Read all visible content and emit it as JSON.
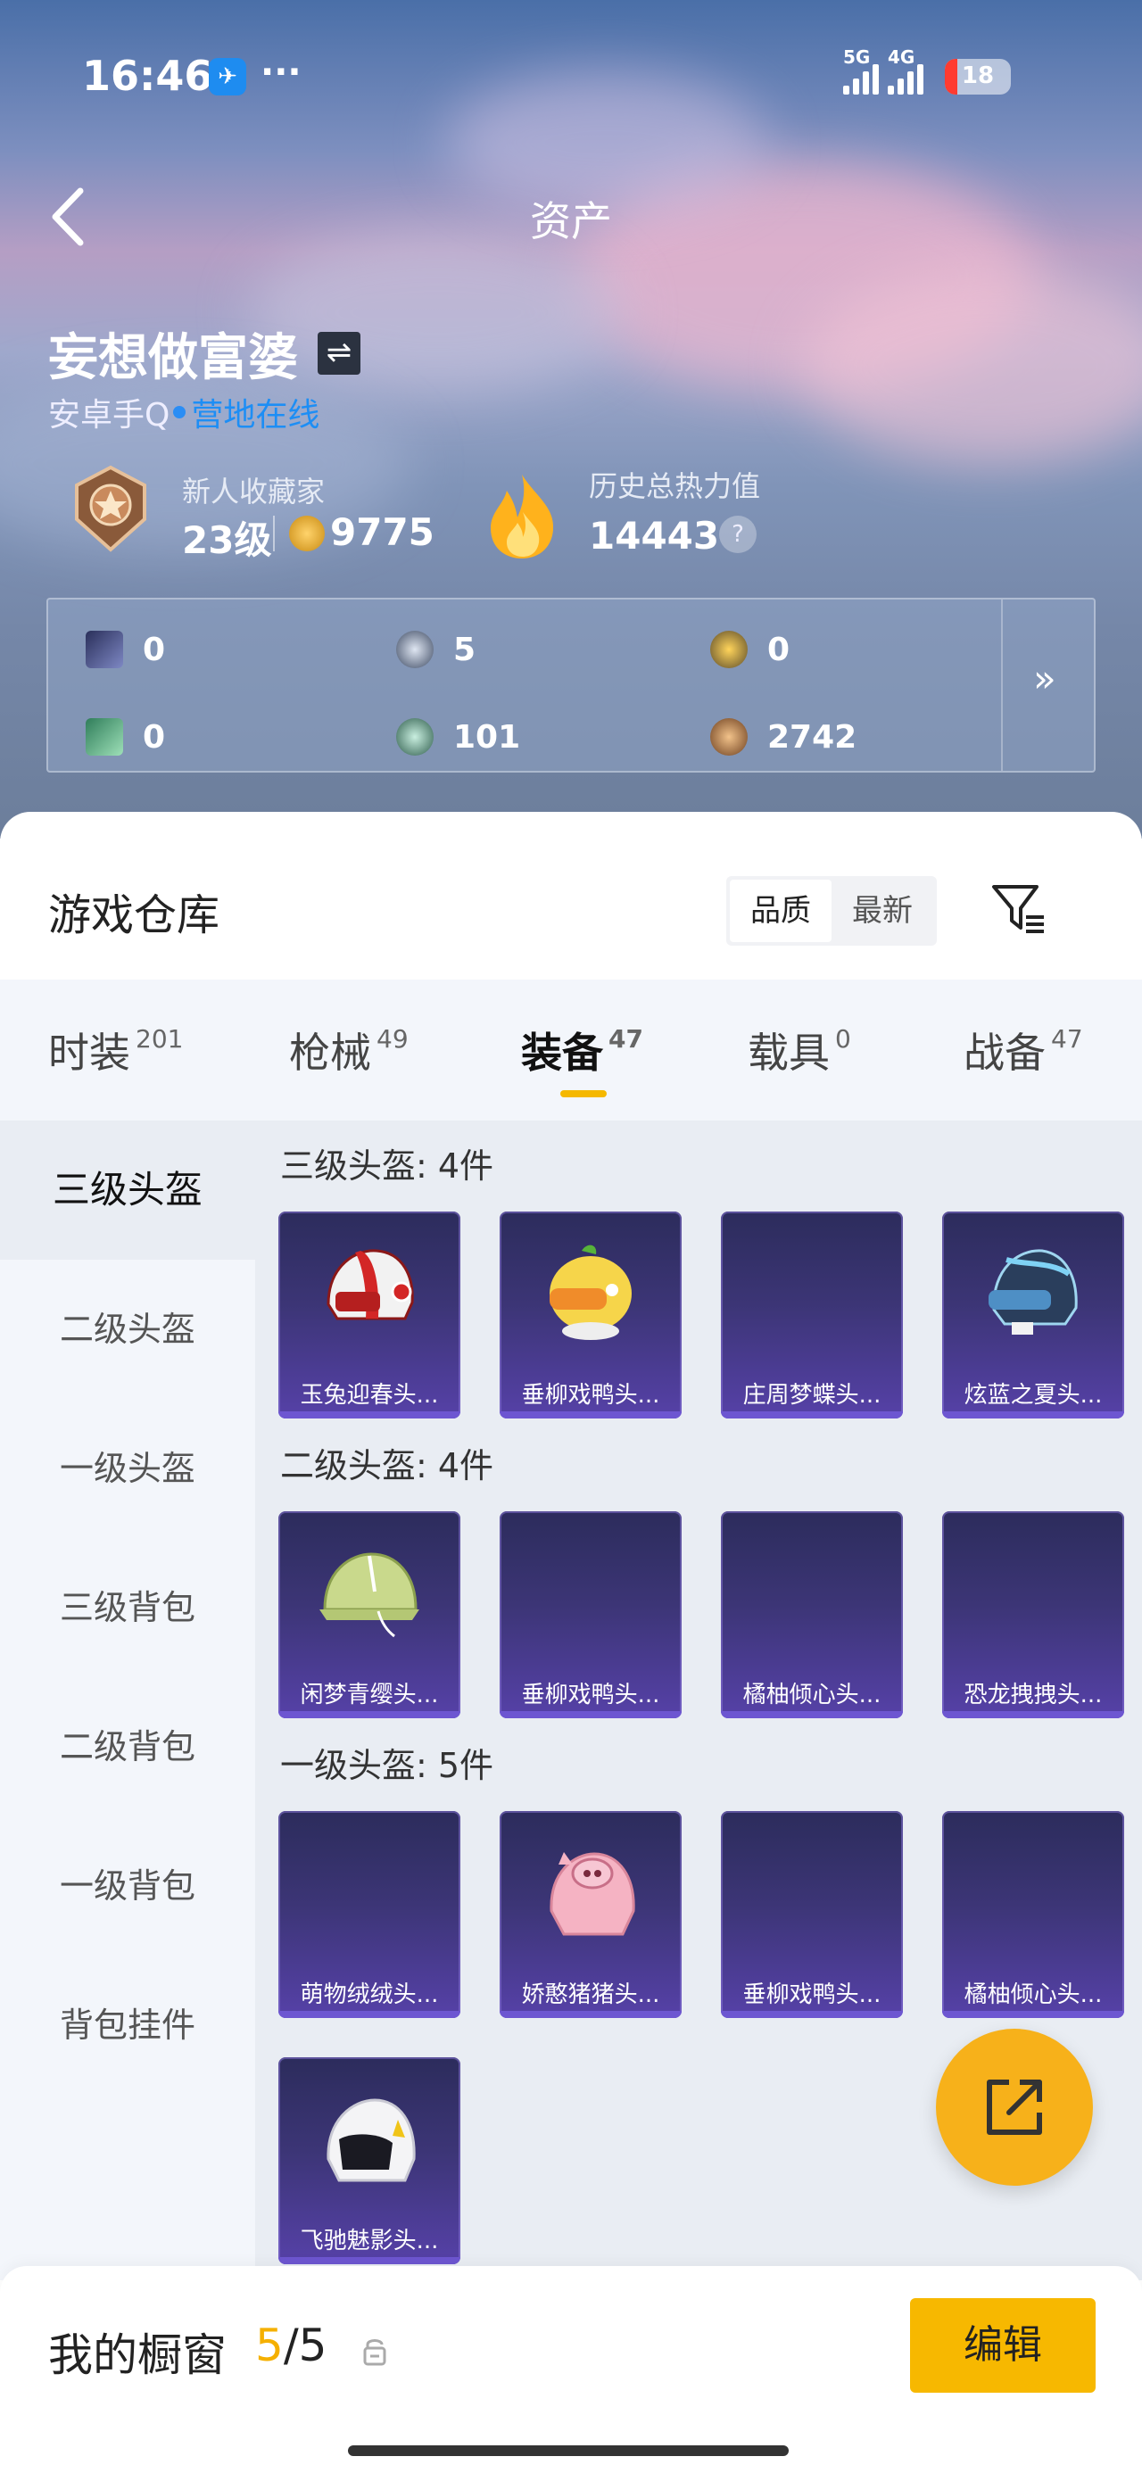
{
  "status_bar": {
    "time": "16:46",
    "more": "···",
    "net1": "5G",
    "net2": "4G",
    "battery": "18"
  },
  "header": {
    "title": "资产"
  },
  "profile": {
    "username": "妄想做富婆",
    "platform": "安卓手Q",
    "online_status": "营地在线",
    "rank_title": "新人收藏家",
    "level": "23级",
    "points": "9775",
    "history_label": "历史总热力值",
    "history_value": "14443",
    "help": "?"
  },
  "currencies": [
    {
      "icon": "card-icon",
      "value": "0"
    },
    {
      "icon": "token-icon",
      "value": "5"
    },
    {
      "icon": "coupon-icon",
      "value": "0"
    },
    {
      "icon": "ticket-icon",
      "value": "0"
    },
    {
      "icon": "coin-icon",
      "value": "101"
    },
    {
      "icon": "medal-coin-icon",
      "value": "2742"
    }
  ],
  "panel_more": "»",
  "warehouse": {
    "title": "游戏仓库",
    "sort_options": [
      "品质",
      "最新"
    ],
    "sort_selected": "品质"
  },
  "tabs": [
    {
      "label": "时装",
      "count": "201"
    },
    {
      "label": "枪械",
      "count": "49"
    },
    {
      "label": "装备",
      "count": "47",
      "active": true
    },
    {
      "label": "载具",
      "count": "0"
    },
    {
      "label": "战备",
      "count": "47"
    }
  ],
  "sidebar": [
    "三级头盔",
    "二级头盔",
    "一级头盔",
    "三级背包",
    "二级背包",
    "一级背包",
    "背包挂件"
  ],
  "sections": [
    {
      "title": "三级头盔: 4件",
      "items": [
        "玉兔迎春头...",
        "垂柳戏鸭头...",
        "庄周梦蝶头...",
        "炫蓝之夏头..."
      ]
    },
    {
      "title": "二级头盔: 4件",
      "items": [
        "闲梦青缨头...",
        "垂柳戏鸭头...",
        "橘柚倾心头...",
        "恐龙拽拽头..."
      ]
    },
    {
      "title": "一级头盔: 5件",
      "items": [
        "萌物绒绒头...",
        "娇憨猪猪头...",
        "垂柳戏鸭头...",
        "橘柚倾心头...",
        "飞驰魅影头..."
      ]
    }
  ],
  "showcase": {
    "title": "我的橱窗",
    "count_current": "5",
    "count_total": "/5",
    "edit_label": "编辑"
  },
  "colors": {
    "accent": "#f7b800",
    "online": "#1d8ef5",
    "card": "#3c3576"
  }
}
